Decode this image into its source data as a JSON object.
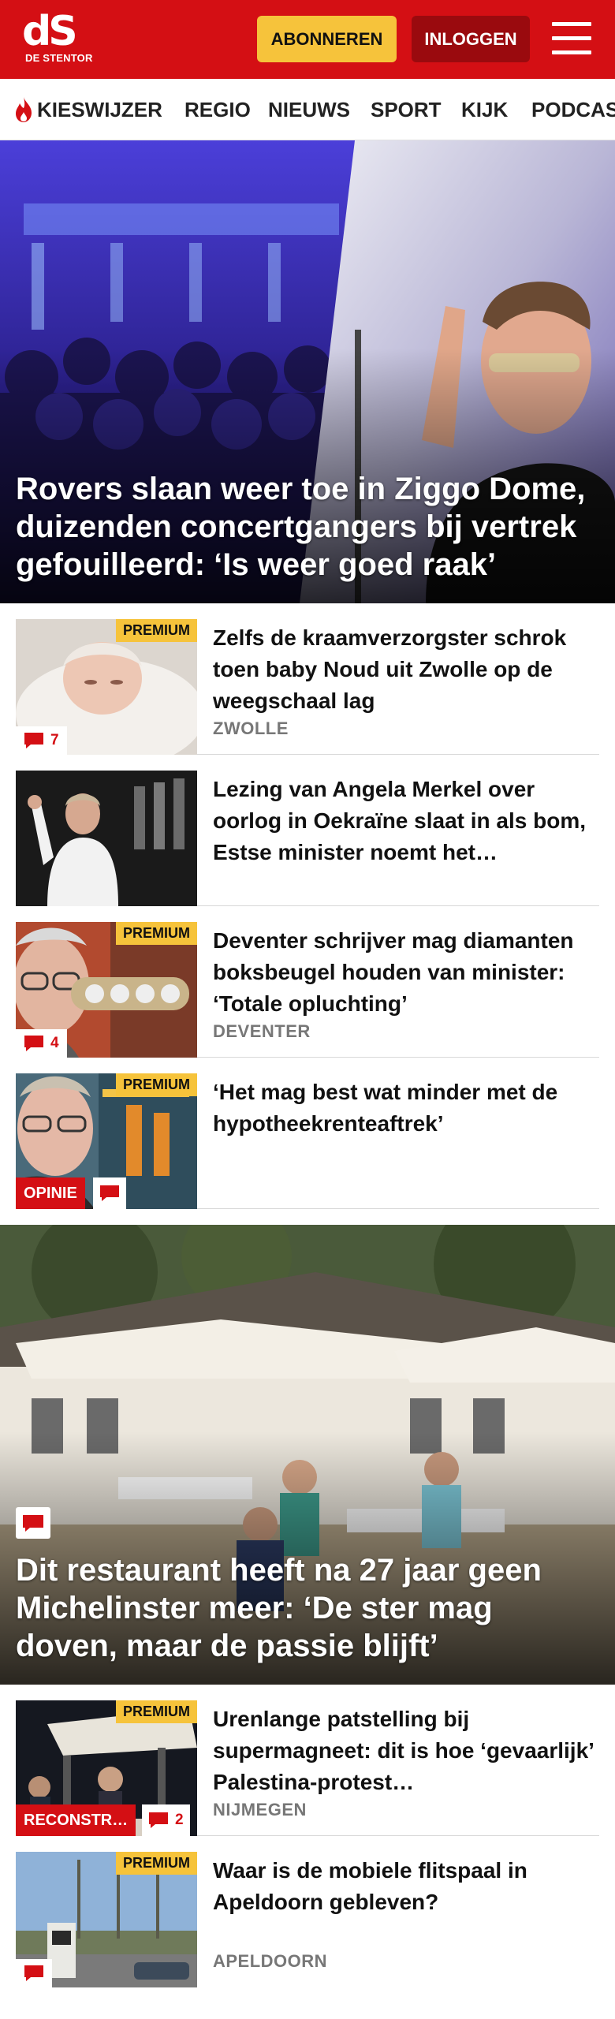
{
  "header": {
    "logo_mark": "dS",
    "logo_subtitle": "DE STENTOR",
    "subscribe_label": "ABONNEREN",
    "login_label": "INLOGGEN",
    "menu_icon": "hamburger-menu-icon",
    "brand_color": "#d40f14",
    "subscribe_color": "#f6c33b",
    "login_color": "#9a0a0e"
  },
  "nav": {
    "items": [
      {
        "label": "KIESWIJZER",
        "icon": "flame-icon"
      },
      {
        "label": "REGIO"
      },
      {
        "label": "NIEUWS"
      },
      {
        "label": "SPORT"
      },
      {
        "label": "KIJK"
      },
      {
        "label": "PODCAS"
      }
    ]
  },
  "hero1": {
    "title": "Rovers slaan weer toe in Ziggo Dome, duizenden concertgangers bij vertrek gefouilleerd: ‘Is weer goed raak’"
  },
  "articles_group1": [
    {
      "title": "Zelfs de kraamverzorgster schrok toen baby Noud uit Zwolle op de weegschaal lag",
      "section": "ZWOLLE",
      "premium": "PREMIUM",
      "comments": "7"
    },
    {
      "title": "Lezing van Angela Merkel over oorlog in Oekraïne slaat in als bom, Estse minister noemt het…"
    },
    {
      "title": "Deventer schrijver mag diamanten boksbeugel houden van minister: ‘Totale opluchting’",
      "section": "DEVENTER",
      "premium": "PREMIUM",
      "comments": "4"
    },
    {
      "title": "‘Het mag best wat minder met de hypotheekrenteaftrek’",
      "premium": "PREMIUM",
      "label": "OPINIE"
    }
  ],
  "hero2": {
    "title": "Dit restaurant heeft na 27 jaar geen Michelinster meer: ‘De ster mag doven, maar de passie blijft’",
    "comment_icon": "comment-bubble-icon"
  },
  "articles_group2": [
    {
      "title": "Urenlange patstelling bij supermagneet: dit is hoe ‘gevaarlijk’ Palestina-protest…",
      "section": "NIJMEGEN",
      "premium": "PREMIUM",
      "label": "RECONSTR…",
      "comments": "2"
    },
    {
      "title": "Waar is de mobiele flitspaal in Apeldoorn gebleven?",
      "section": "APELDOORN",
      "premium": "PREMIUM"
    }
  ]
}
